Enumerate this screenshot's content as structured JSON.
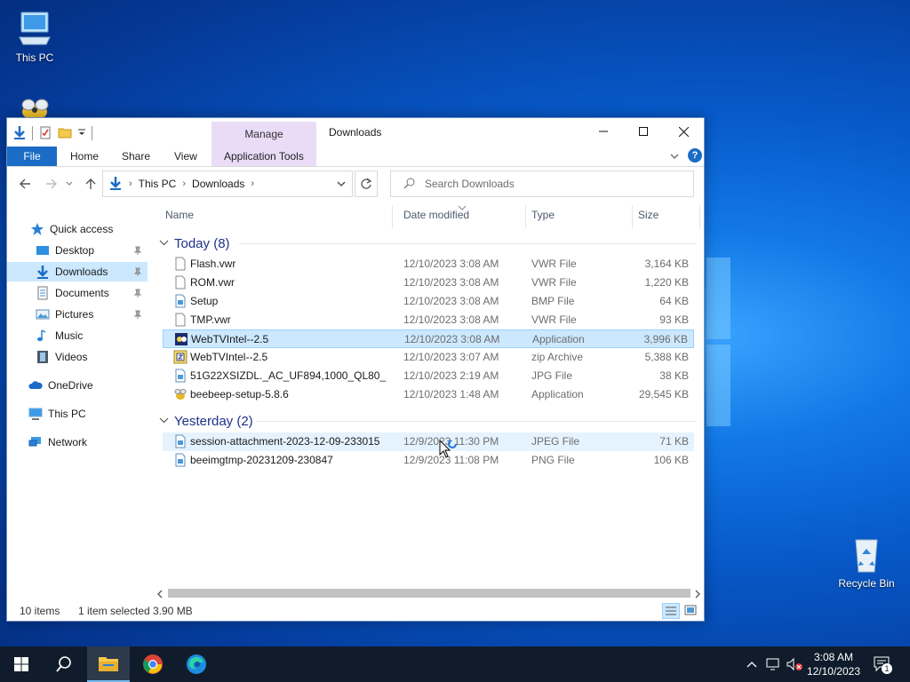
{
  "desktop": {
    "icons": [
      {
        "label": "This PC"
      },
      {
        "label": "Recycle Bin"
      }
    ]
  },
  "window": {
    "title": "Downloads",
    "manage_tab": "Manage",
    "tabs": {
      "file": "File",
      "home": "Home",
      "share": "Share",
      "view": "View",
      "app_tools": "Application Tools"
    },
    "address": {
      "crumb1": "This PC",
      "crumb2": "Downloads"
    },
    "search": {
      "placeholder": "Search Downloads"
    },
    "navpane": {
      "quick_access": "Quick access",
      "desktop": "Desktop",
      "downloads": "Downloads",
      "documents": "Documents",
      "pictures": "Pictures",
      "music": "Music",
      "videos": "Videos",
      "onedrive": "OneDrive",
      "thispc": "This PC",
      "network": "Network"
    },
    "columns": {
      "name": "Name",
      "date": "Date modified",
      "type": "Type",
      "size": "Size"
    },
    "groups": [
      {
        "label": "Today (8)",
        "files": [
          {
            "name": "Flash.vwr",
            "date": "12/10/2023 3:08 AM",
            "type": "VWR File",
            "size": "3,164 KB",
            "icon": "blank-file-icon"
          },
          {
            "name": "ROM.vwr",
            "date": "12/10/2023 3:08 AM",
            "type": "VWR File",
            "size": "1,220 KB",
            "icon": "blank-file-icon"
          },
          {
            "name": "Setup",
            "date": "12/10/2023 3:08 AM",
            "type": "BMP File",
            "size": "64 KB",
            "icon": "image-file-icon"
          },
          {
            "name": "TMP.vwr",
            "date": "12/10/2023 3:08 AM",
            "type": "VWR File",
            "size": "93 KB",
            "icon": "blank-file-icon"
          },
          {
            "name": "WebTVIntel--2.5",
            "date": "12/10/2023 3:08 AM",
            "type": "Application",
            "size": "3,996 KB",
            "icon": "application-icon"
          },
          {
            "name": "WebTVIntel--2.5",
            "date": "12/10/2023 3:07 AM",
            "type": "zip Archive",
            "size": "5,388 KB",
            "icon": "zip-archive-icon"
          },
          {
            "name": "51G22XSIZDL._AC_UF894,1000_QL80_",
            "date": "12/10/2023 2:19 AM",
            "type": "JPG File",
            "size": "38 KB",
            "icon": "image-file-icon"
          },
          {
            "name": "beebeep-setup-5.8.6",
            "date": "12/10/2023 1:48 AM",
            "type": "Application",
            "size": "29,545 KB",
            "icon": "beebeep-app-icon"
          }
        ]
      },
      {
        "label": "Yesterday (2)",
        "files": [
          {
            "name": "session-attachment-2023-12-09-233015",
            "date": "12/9/2023 11:30 PM",
            "type": "JPEG File",
            "size": "71 KB",
            "icon": "image-file-icon"
          },
          {
            "name": "beeimgtmp-20231209-230847",
            "date": "12/9/2023 11:08 PM",
            "type": "PNG File",
            "size": "106 KB",
            "icon": "image-file-icon"
          }
        ]
      }
    ],
    "status": {
      "items": "10 items",
      "selected": "1 item selected",
      "size": "3.90 MB"
    }
  },
  "taskbar": {
    "time": "3:08 AM",
    "date": "12/10/2023",
    "notification_count": "1"
  },
  "colors": {
    "accent": "#1a6cc6",
    "selection": "#cce8ff",
    "manage_tab": "#eadcf7",
    "taskbar": "#101c2b"
  }
}
